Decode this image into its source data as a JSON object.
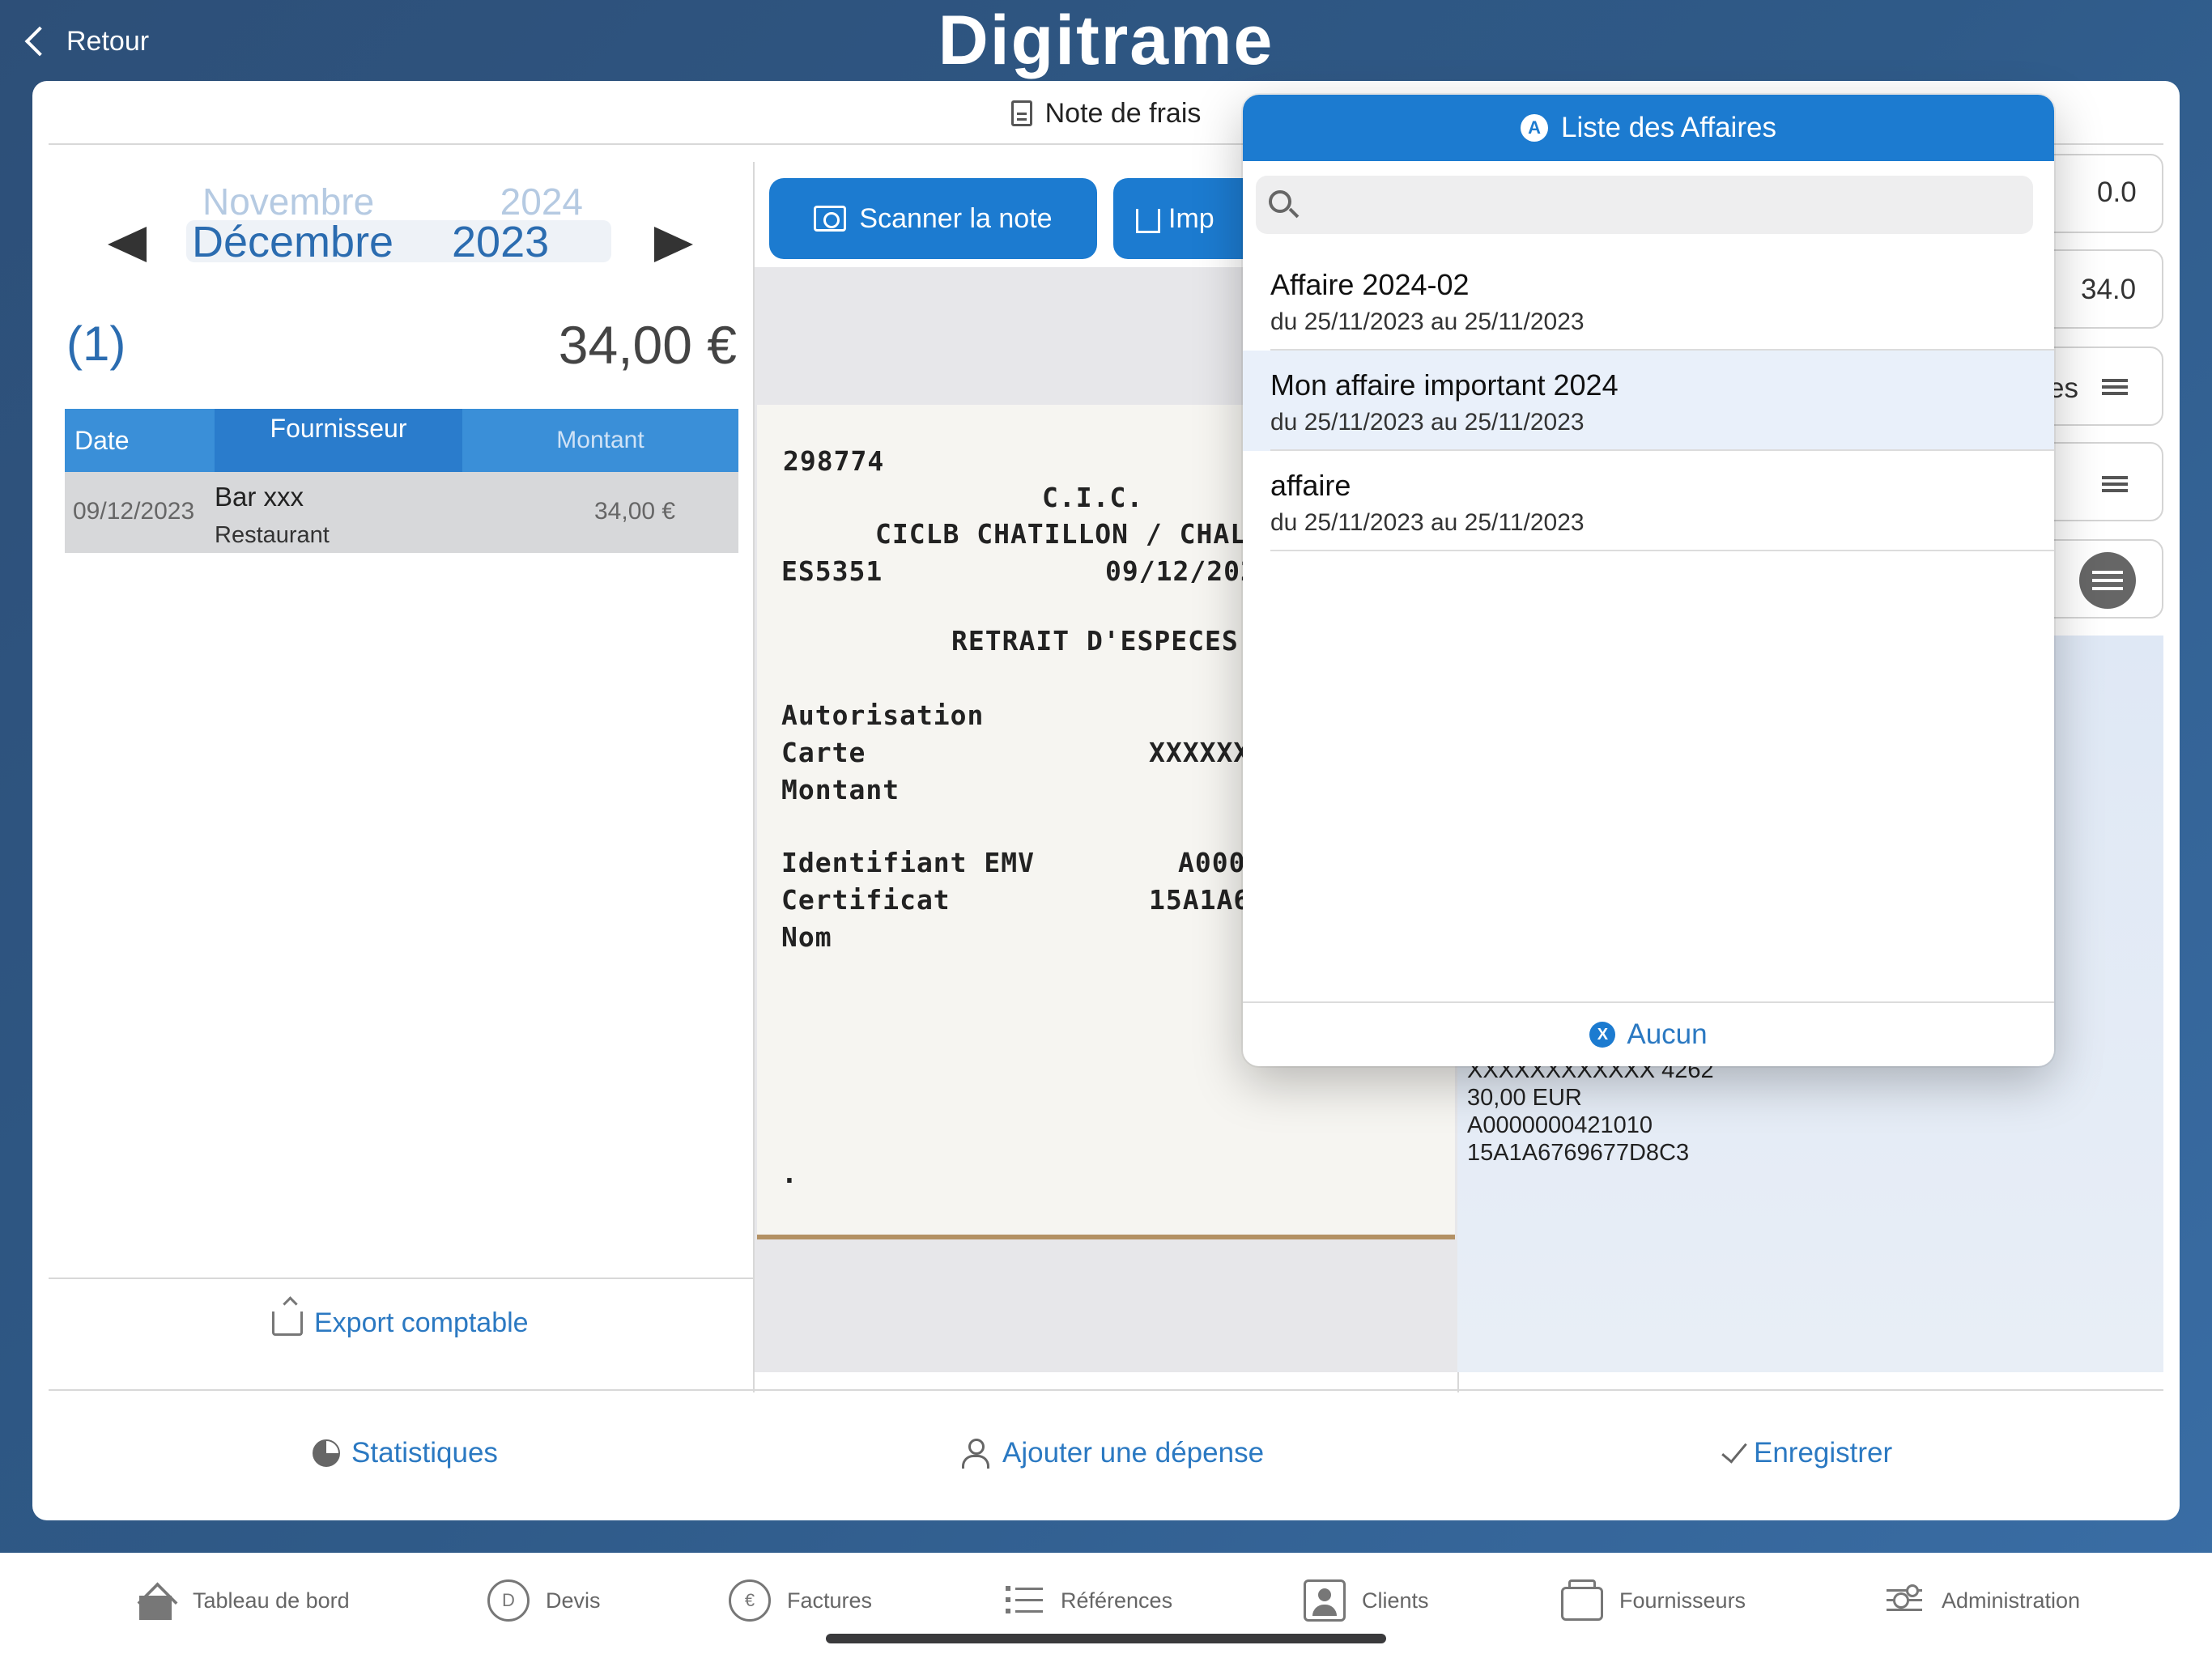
{
  "header": {
    "back_label": "Retour",
    "app_name": "Digitrame"
  },
  "page": {
    "title": "Note de frais"
  },
  "month_picker": {
    "prev_month": "Novembre",
    "prev_year": "2024",
    "current_month": "Décembre",
    "current_year": "2023"
  },
  "summary": {
    "count": "(1)",
    "total": "34,00 €"
  },
  "table": {
    "headers": [
      "Date",
      "Fournisseur",
      "Montant"
    ],
    "rows": [
      {
        "date": "09/12/2023",
        "supplier": "Bar xxx",
        "category": "Restaurant",
        "amount": "34,00 €"
      }
    ]
  },
  "left_footer": {
    "export_label": "Export comptable"
  },
  "toolbar": {
    "scan_label": "Scanner la note",
    "import_label": "Imp"
  },
  "receipt": {
    "lines": [
      "298774",
      "C.I.C.",
      "CICLB CHATILLON / CHALAR",
      "ES5351",
      "09/12/202",
      "RETRAIT D'ESPECES",
      "Autorisation",
      "Carte",
      "XXXXXX",
      "Montant",
      "Identifiant EMV",
      "A000",
      "Certificat",
      "15A1A6",
      "Nom",
      "."
    ]
  },
  "right_fields": {
    "f1": "0.0",
    "f2": "34.0",
    "f3": "es"
  },
  "ocr_text": {
    "lines": [
      "XXXXXXXXXXXX 4262",
      "30,00 EUR",
      "A0000000421010",
      "15A1A6769677D8C3"
    ]
  },
  "actions": {
    "stats_label": "Statistiques",
    "add_label": "Ajouter une dépense",
    "save_label": "Enregistrer"
  },
  "popover": {
    "title": "Liste des Affaires",
    "title_badge": "A",
    "search_placeholder": "",
    "items": [
      {
        "title": "Affaire 2024-02",
        "dates": "du 25/11/2023 au 25/11/2023"
      },
      {
        "title": "Mon affaire important 2024",
        "dates": "du 25/11/2023 au 25/11/2023"
      },
      {
        "title": "affaire",
        "dates": "du 25/11/2023 au 25/11/2023"
      }
    ],
    "none_badge": "X",
    "none_label": "Aucun"
  },
  "tabbar": {
    "items": [
      {
        "label": "Tableau de bord",
        "icon": "home-icon"
      },
      {
        "label": "Devis",
        "icon": "d-circle-icon",
        "glyph": "D"
      },
      {
        "label": "Factures",
        "icon": "euro-circle-icon",
        "glyph": "€"
      },
      {
        "label": "Références",
        "icon": "list-icon"
      },
      {
        "label": "Clients",
        "icon": "contact-card-icon"
      },
      {
        "label": "Fournisseurs",
        "icon": "stack-icon"
      },
      {
        "label": "Administration",
        "icon": "sliders-icon"
      }
    ]
  },
  "colors": {
    "accent": "#1c7bd0",
    "link": "#2b79c2",
    "table_header": "#3a8fd8",
    "selected_row": "#e9f0fa"
  }
}
